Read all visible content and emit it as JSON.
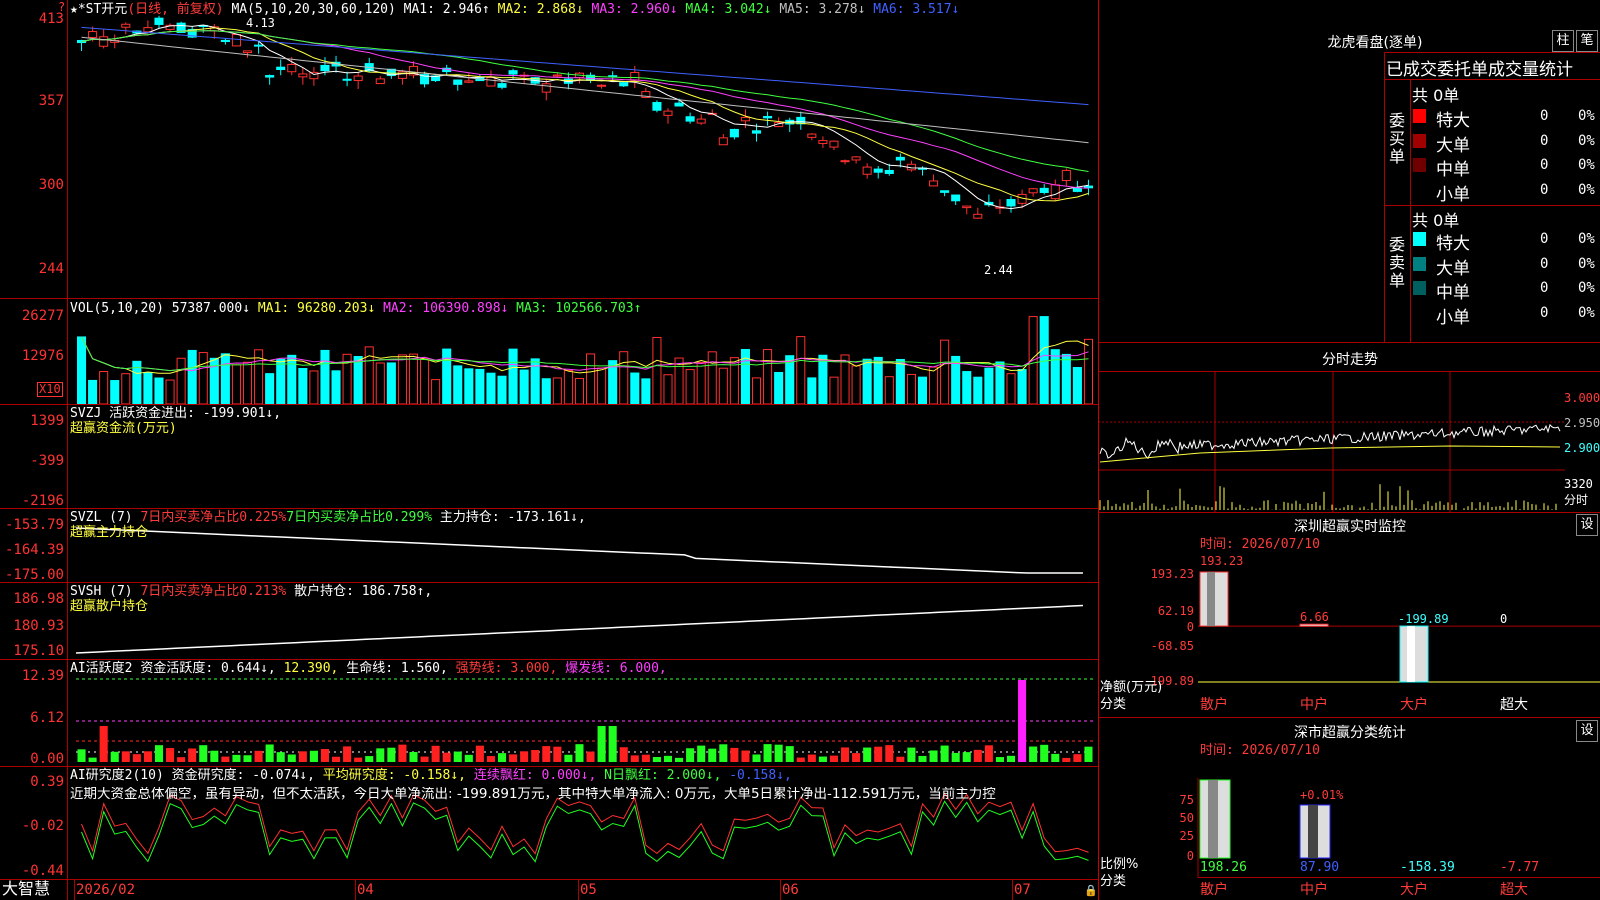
{
  "kline": {
    "stock_name": "*ST开元",
    "period_label": "(日线, 前复权)",
    "ma_params": "MA(5,10,20,30,60,120)",
    "ma_values": [
      {
        "name": "MA1",
        "value": "2.946↑",
        "color": "#ffffff"
      },
      {
        "name": "MA2",
        "value": "2.868↓",
        "color": "#ffff40"
      },
      {
        "name": "MA3",
        "value": "2.960↓",
        "color": "#ff40ff"
      },
      {
        "name": "MA4",
        "value": "3.042↓",
        "color": "#40ff40"
      },
      {
        "name": "MA5",
        "value": "3.278↓",
        "color": "#c0c0c0"
      },
      {
        "name": "MA6",
        "value": "3.517↓",
        "color": "#4060ff"
      }
    ],
    "y_ticks": [
      "413",
      "357",
      "300",
      "244"
    ],
    "high_mark": "4.13",
    "low_mark": "2.44"
  },
  "vol": {
    "header": "VOL(5,10,20)",
    "value": "57387.000↓",
    "ma": [
      {
        "name": "MA1",
        "value": "96280.203↓",
        "color": "#ffff40"
      },
      {
        "name": "MA2",
        "value": "106390.898↓",
        "color": "#ff40ff"
      },
      {
        "name": "MA3",
        "value": "102566.703↑",
        "color": "#40ff40"
      }
    ],
    "y_ticks": [
      "26277",
      "12976"
    ],
    "unit": "X10"
  },
  "svzj": {
    "header": "SVZJ",
    "text": "活跃资金进出: -199.901↓,",
    "subtitle": "超赢资金流(万元)",
    "y_ticks": [
      "1399",
      "-399",
      "-2196"
    ]
  },
  "svzl": {
    "header": "SVZL (7)",
    "t1": "7日内买卖净占比0.225%",
    "t2": "7日内买卖净占比0.299%",
    "t3": "主力持仓: -173.161↓,",
    "subtitle": "超赢主力持仓",
    "y_ticks": [
      "-153.79",
      "-164.39",
      "-175.00"
    ]
  },
  "svsh": {
    "header": "SVSH (7)",
    "t1": "7日内买卖净占比0.213%",
    "t2": "散户持仓: 186.758↑,",
    "subtitle": "超赢散户持仓",
    "y_ticks": [
      "186.98",
      "180.93",
      "175.10"
    ]
  },
  "ai1": {
    "header": "AI活跃度2",
    "t1": "资金活跃度: 0.644↓,",
    "t2": "12.390,",
    "t3": "生命线: 1.560,",
    "t4": "强势线: 3.000,",
    "t5": "爆发线: 6.000,",
    "y_ticks": [
      "12.39",
      "6.12",
      "0.00"
    ]
  },
  "ai2": {
    "header": "AI研究度2(10)",
    "t1": "资金研究度: -0.074↓,",
    "t2": "平均研究度: -0.158↓,",
    "t3": "连续飘红: 0.000↓,",
    "t4": "N日飘红: 2.000↓,",
    "t5": "-0.158↓,",
    "comment": "近期大资金总体偏空，虽有异动，但不太活跃，今日大单净流出: -199.891万元，其中特大单净流入: 0万元，大单5日累计净出-112.591万元，当前主力控",
    "y_ticks": [
      "0.39",
      "-0.02",
      "-0.44"
    ]
  },
  "time_axis": {
    "labels": [
      "2026/02",
      "04",
      "05",
      "06",
      "07"
    ],
    "app_name": "大智慧"
  },
  "right": {
    "lhb_title": "龙虎看盘(逐单)",
    "btn1": "柱",
    "btn2": "笔",
    "stats_title": "已成交委托单成交量统计",
    "buy_side": "委买单",
    "sell_side": "委卖单",
    "buy_total": "共 0单",
    "sell_total": "共 0单",
    "buy_rows": [
      {
        "label": "特大",
        "count": "0",
        "pct": "0%",
        "color": "#ff0000"
      },
      {
        "label": "大单",
        "count": "0",
        "pct": "0%",
        "color": "#a00000"
      },
      {
        "label": "中单",
        "count": "0",
        "pct": "0%",
        "color": "#700000"
      },
      {
        "label": "小单",
        "count": "0",
        "pct": "0%",
        "color": "#000000"
      }
    ],
    "sell_rows": [
      {
        "label": "特大",
        "count": "0",
        "pct": "0%",
        "color": "#00ffff"
      },
      {
        "label": "大单",
        "count": "0",
        "pct": "0%",
        "color": "#008080"
      },
      {
        "label": "中单",
        "count": "0",
        "pct": "0%",
        "color": "#006060"
      },
      {
        "label": "小单",
        "count": "0",
        "pct": "0%",
        "color": "#000000"
      }
    ],
    "intraday_title": "分时走势",
    "intraday_ticks": [
      "3.000",
      "2.950",
      "2.900"
    ],
    "intraday_vol": "3320",
    "intraday_unit": "分时",
    "sz_title": "深圳超赢实时监控",
    "set_label": "设",
    "date1": "时间: 2026/07/10",
    "sz_ticks": [
      "193.23",
      "62.19",
      "0",
      "-68.85",
      "-199.89"
    ],
    "sz_values": [
      "193.23",
      "6.66",
      "-199.89",
      "0"
    ],
    "sz_ylabel": "净额(万元)",
    "sz_xlabel": "分类",
    "categories": [
      "散户",
      "中户",
      "大户",
      "超大"
    ],
    "cls_title": "深市超赢分类统计",
    "date2": "时间: 2026/07/10",
    "cls_ticks": [
      "75",
      "50",
      "25",
      "0"
    ],
    "cls_pct": "+0.01%",
    "cls_values": [
      "198.26",
      "87.90",
      "-158.39",
      "-7.77"
    ],
    "cls_ylabel": "比例%",
    "cls_xlabel": "分类"
  },
  "chart_data": [
    {
      "type": "candlestick",
      "title": "*ST开元 (日线, 前复权)",
      "ylim": [
        2.44,
        4.13
      ],
      "note": "daily price with MA(5,10,20,30,60,120)"
    },
    {
      "type": "bar",
      "title": "VOL(5,10,20)",
      "ylim": [
        0,
        26277
      ]
    },
    {
      "type": "bar",
      "title": "超赢资金流(万元)",
      "ylim": [
        -2196,
        1399
      ]
    },
    {
      "type": "line",
      "title": "超赢主力持仓",
      "ylim": [
        -175.0,
        -153.79
      ]
    },
    {
      "type": "line",
      "title": "超赢散户持仓",
      "ylim": [
        175.1,
        186.98
      ]
    },
    {
      "type": "bar",
      "title": "AI活跃度2",
      "ylim": [
        0,
        12.39
      ]
    },
    {
      "type": "bar",
      "title": "AI研究度2(10)",
      "ylim": [
        -0.44,
        0.39
      ]
    },
    {
      "type": "bar",
      "title": "深圳超赢实时监控",
      "categories": [
        "散户",
        "中户",
        "大户",
        "超大"
      ],
      "values": [
        193.23,
        6.66,
        -199.89,
        0
      ],
      "ylim": [
        -199.89,
        193.23
      ]
    },
    {
      "type": "bar",
      "title": "深市超赢分类统计",
      "categories": [
        "散户",
        "中户",
        "大户",
        "超大"
      ],
      "values": [
        198.26,
        87.9,
        -158.39,
        -7.77
      ]
    }
  ]
}
